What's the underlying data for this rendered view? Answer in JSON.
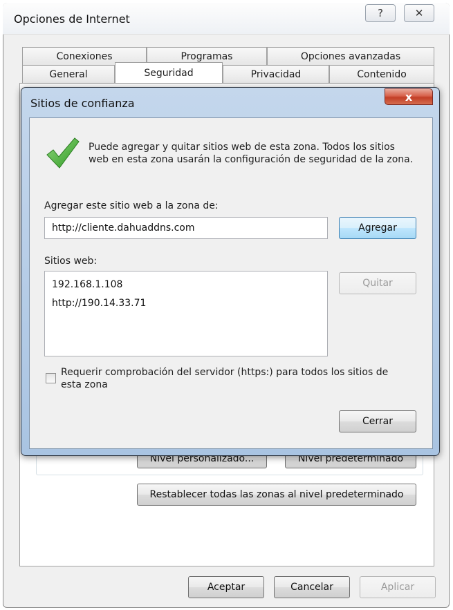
{
  "outer_dialog": {
    "title": "Opciones de Internet",
    "help_glyph": "?",
    "close_glyph": "✕",
    "tabs_row1": [
      "Conexiones",
      "Programas",
      "Opciones avanzadas"
    ],
    "tabs_row2": [
      "General",
      "Seguridad",
      "Privacidad",
      "Contenido"
    ],
    "active_tab": "Seguridad",
    "custom_level_button": "Nivel personalizado...",
    "default_level_button": "Nivel predeterminado",
    "reset_all_button": "Restablecer todas las zonas al nivel predeterminado",
    "ok_button": "Aceptar",
    "cancel_button": "Cancelar",
    "apply_button": "Aplicar"
  },
  "trusted_sites_dialog": {
    "title": "Sitios de confianza",
    "close_glyph": "x",
    "info_text": "Puede agregar y quitar sitios web de esta zona. Todos los sitios web en esta zona usarán la configuración de seguridad de la zona.",
    "add_label": "Agregar este sitio web a la zona de:",
    "add_input_value": "http://cliente.dahuaddns.com",
    "add_button": "Agregar",
    "websites_label": "Sitios web:",
    "websites": [
      "192.168.1.108",
      "http://190.14.33.71"
    ],
    "remove_button": "Quitar",
    "require_https_label": "Requerir comprobación del servidor (https:) para todos los sitios de esta zona",
    "require_https_checked": false,
    "close_button": "Cerrar"
  },
  "colors": {
    "accent_check": "#3fa82f",
    "close_button_red": "#c23e26",
    "frame_blue": "#b9cfe8"
  }
}
